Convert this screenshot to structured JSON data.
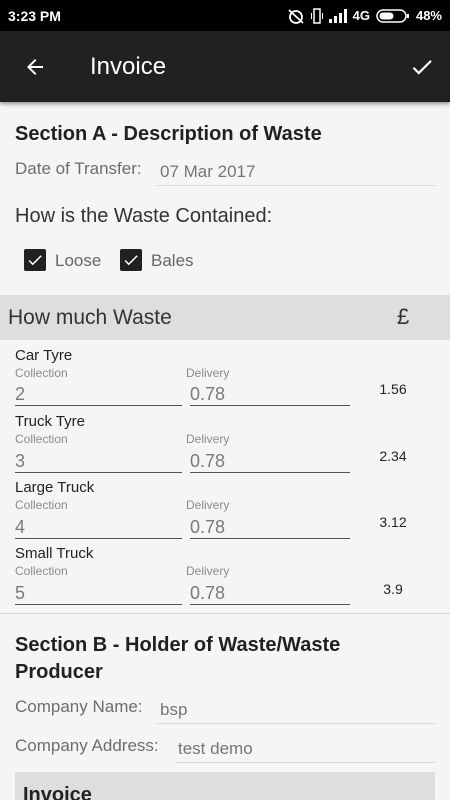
{
  "status_bar": {
    "time": "3:23 PM",
    "network": "4G",
    "battery": "48%"
  },
  "app_bar": {
    "title": "Invoice"
  },
  "section_a": {
    "title": "Section A - Description of Waste",
    "date_label": "Date of Transfer:",
    "date_value": "07 Mar 2017",
    "question": "How is the Waste Contained:",
    "options": [
      {
        "label": "Loose",
        "checked": true
      },
      {
        "label": "Bales",
        "checked": true
      }
    ]
  },
  "waste": {
    "header": "How much Waste",
    "currency": "£",
    "collection_label": "Collection",
    "delivery_label": "Delivery",
    "rows": [
      {
        "name": "Car Tyre",
        "collection": "2",
        "delivery": "0.78",
        "total": "1.56"
      },
      {
        "name": "Truck Tyre",
        "collection": "3",
        "delivery": "0.78",
        "total": "2.34"
      },
      {
        "name": "Large Truck",
        "collection": "4",
        "delivery": "0.78",
        "total": "3.12"
      },
      {
        "name": "Small Truck",
        "collection": "5",
        "delivery": "0.78",
        "total": "3.9"
      }
    ]
  },
  "section_b": {
    "title": "Section B - Holder of Waste/Waste Producer",
    "company_name_label": "Company Name:",
    "company_name_value": "bsp",
    "company_address_label": "Company Address:",
    "company_address_value": "test demo",
    "invoice_label": "Invoice"
  }
}
